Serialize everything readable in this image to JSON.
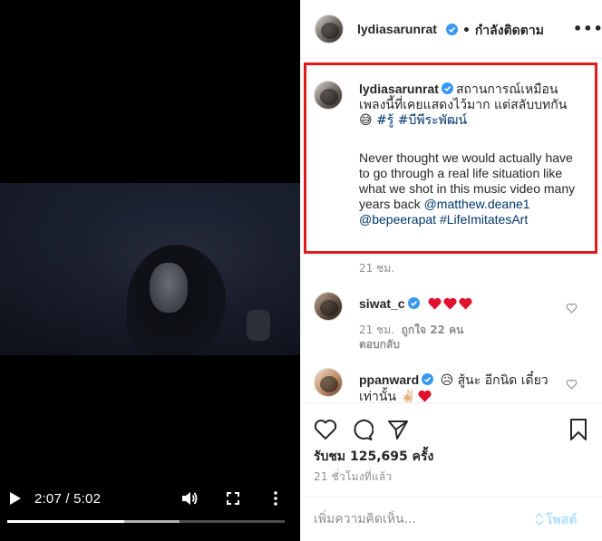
{
  "video": {
    "current_time": "2:07",
    "separator": "/",
    "duration": "5:02",
    "progress_fraction": 0.42,
    "buffered_fraction": 0.62
  },
  "header": {
    "username": "lydiasarunrat",
    "separator": "•",
    "follow_state": "กำลังติดตาม",
    "more": "•••"
  },
  "caption": {
    "username": "lydiasarunrat",
    "text_th": "สถานการณ์เหมือนเพลงนี้ที่เคยแสดงไว้มาก แต่สลับบทกัน 😅",
    "hashtag1": "#รู้",
    "hashtag2": "#บีพีระพัฒน์",
    "text_en": "Never thought we would actually have to go through a real life situation like what we shot in this music video many years back",
    "mention1": "@matthew.deane1",
    "mention2": "@bepeerapat",
    "hashtag_en": "#LifeImitatesArt",
    "time": "21 ชม."
  },
  "comments": [
    {
      "username": "siwat_c",
      "text": "",
      "time": "21 ชม.",
      "likes": "ถูกใจ 22 คน",
      "reply": "ตอบกลับ"
    },
    {
      "username": "ppanward",
      "text": "😥 สู้นะ อีกนิด เดี๋ยวเท่านั้น ✌🏻",
      "time": "",
      "likes": "",
      "reply": ""
    }
  ],
  "post": {
    "likes_label": "รับชม 125,695 ครั้ง",
    "time_ago": "21 ชั่วโมงที่แล้ว"
  },
  "comment_bar": {
    "placeholder": "เพิ่มความคิดเห็น...",
    "post_label": "โพสต์"
  },
  "colors": {
    "highlight_border": "#e01b1b",
    "verified_blue": "#3897f0",
    "link_blue": "#00376b",
    "heart_red": "#e0102f",
    "post_disabled": "#b2dffc"
  },
  "icons": [
    "play-icon",
    "volume-icon",
    "fullscreen-icon",
    "more-vertical-icon",
    "verified-badge-icon",
    "heart-icon",
    "comment-icon",
    "share-icon",
    "bookmark-icon",
    "emoji-icon"
  ]
}
